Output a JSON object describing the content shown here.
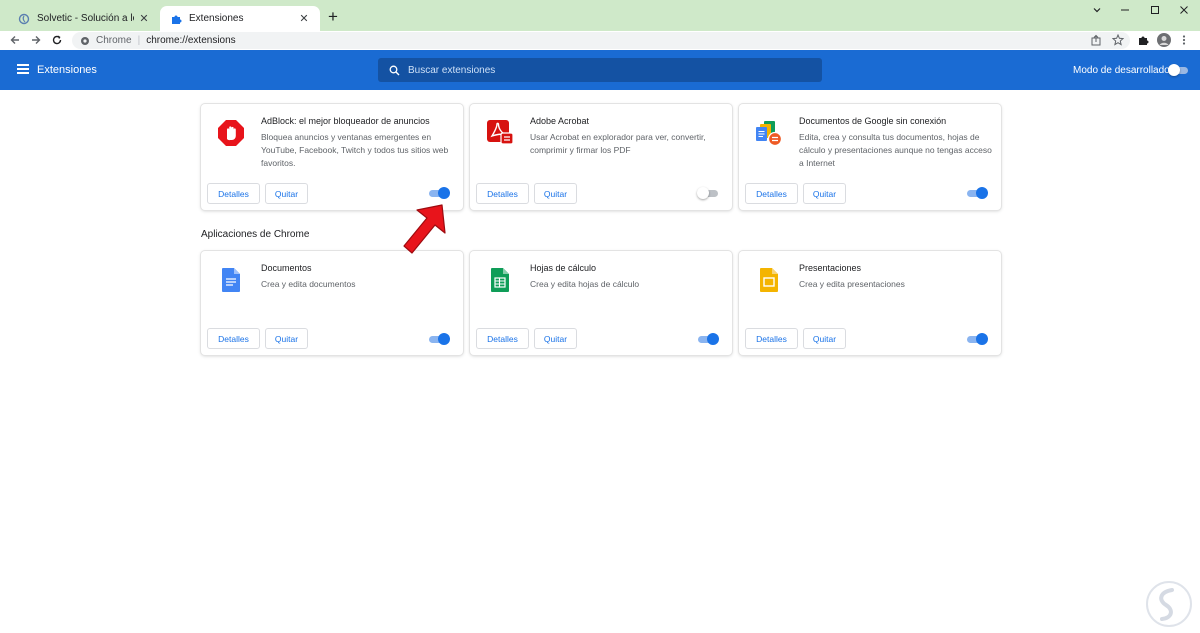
{
  "tabs": [
    {
      "title": "Solvetic - Solución a los problem",
      "icon": "solvetic-favicon"
    },
    {
      "title": "Extensiones",
      "icon": "puzzle-icon"
    }
  ],
  "omnibox": {
    "origin": "Chrome",
    "url": "chrome://extensions"
  },
  "header": {
    "title": "Extensiones",
    "search_placeholder": "Buscar extensiones",
    "dev_mode_label": "Modo de desarrollador",
    "dev_mode_enabled": false
  },
  "extensions": [
    {
      "name": "AdBlock: el mejor bloqueador de anuncios",
      "description": "Bloquea anuncios y ventanas emergentes en YouTube, Facebook, Twitch y todos tus sitios web favoritos.",
      "enabled": true,
      "icon": "adblock-icon"
    },
    {
      "name": "Adobe Acrobat",
      "description": "Usar Acrobat en explorador para ver, convertir, comprimir y firmar los PDF",
      "enabled": false,
      "icon": "acrobat-icon"
    },
    {
      "name": "Documentos de Google sin conexión",
      "description": "Edita, crea y consulta tus documentos, hojas de cálculo y presentaciones aunque no tengas acceso a Internet",
      "enabled": true,
      "icon": "google-docs-offline-icon"
    }
  ],
  "apps_section_title": "Aplicaciones de Chrome",
  "apps": [
    {
      "name": "Documentos",
      "description": "Crea y edita documentos",
      "enabled": true,
      "icon": "docs-icon"
    },
    {
      "name": "Hojas de cálculo",
      "description": "Crea y edita hojas de cálculo",
      "enabled": true,
      "icon": "sheets-icon"
    },
    {
      "name": "Presentaciones",
      "description": "Crea y edita presentaciones",
      "enabled": true,
      "icon": "slides-icon"
    }
  ],
  "buttons": {
    "details": "Detalles",
    "remove": "Quitar"
  },
  "colors": {
    "header_bg": "#1a6bd3",
    "tabstrip_bg": "#cfe9c9",
    "accent": "#1a73e8",
    "annotation_arrow": "#e8141b"
  }
}
